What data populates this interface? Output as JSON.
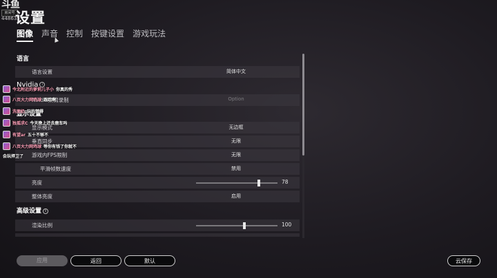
{
  "watermark": {
    "logo": "斗鱼",
    "room_label": "房间号",
    "room_id": "448635"
  },
  "page_title": "设置",
  "tabs": [
    {
      "label": "图像",
      "active": true
    },
    {
      "label": "声音",
      "active": false
    },
    {
      "label": "控制",
      "active": false
    },
    {
      "label": "按键设置",
      "active": false
    },
    {
      "label": "游戏玩法",
      "active": false
    }
  ],
  "sections": {
    "language": "语言",
    "nvidia": "Nvidia",
    "display": "显示设置",
    "advanced": "高级设置"
  },
  "rows": {
    "language_setting": {
      "label": "语言设置",
      "value": "简体中文"
    },
    "nvidia_highlight": {
      "label": "Nvidia集锦录制",
      "value": "Option"
    },
    "display_mode": {
      "label": "显示模式",
      "value": "无边框"
    },
    "vsync": {
      "label": "垂直同步",
      "value": "无限"
    },
    "fps_limit": {
      "label": "游戏内FPS限制",
      "value": "无限"
    },
    "smooth_frame": {
      "label": "平滑帧数速度",
      "value": "禁用"
    },
    "brightness": {
      "label": "亮度",
      "value": "78"
    },
    "overall_brightness": {
      "label": "整体亮度",
      "value": "启用"
    },
    "render_scale": {
      "label": "渲染比例",
      "value": "100"
    }
  },
  "sliders": {
    "brightness_fraction": 0.78,
    "render_scale_fraction": 0.6
  },
  "danmaku": [
    {
      "name": "今北附近的萝莉儿子小",
      "text": "你真的秀"
    },
    {
      "name": "八页大力网鸡球",
      "text": "跟踪啊"
    },
    {
      "name": "洗面奶",
      "text": "玩的梦得"
    },
    {
      "name": "独孤求C",
      "text": "今天晚上还去鹿车吗"
    },
    {
      "name": "有望ar",
      "text": "五十不够不"
    },
    {
      "name": "八页大力网鸡球",
      "text": "等你有钱了你就不"
    },
    {
      "name": "",
      "text": "会玩捍卫了"
    }
  ],
  "buttons": {
    "apply": "应用",
    "back": "返回",
    "default": "默认",
    "cloud_save": "云保存"
  }
}
